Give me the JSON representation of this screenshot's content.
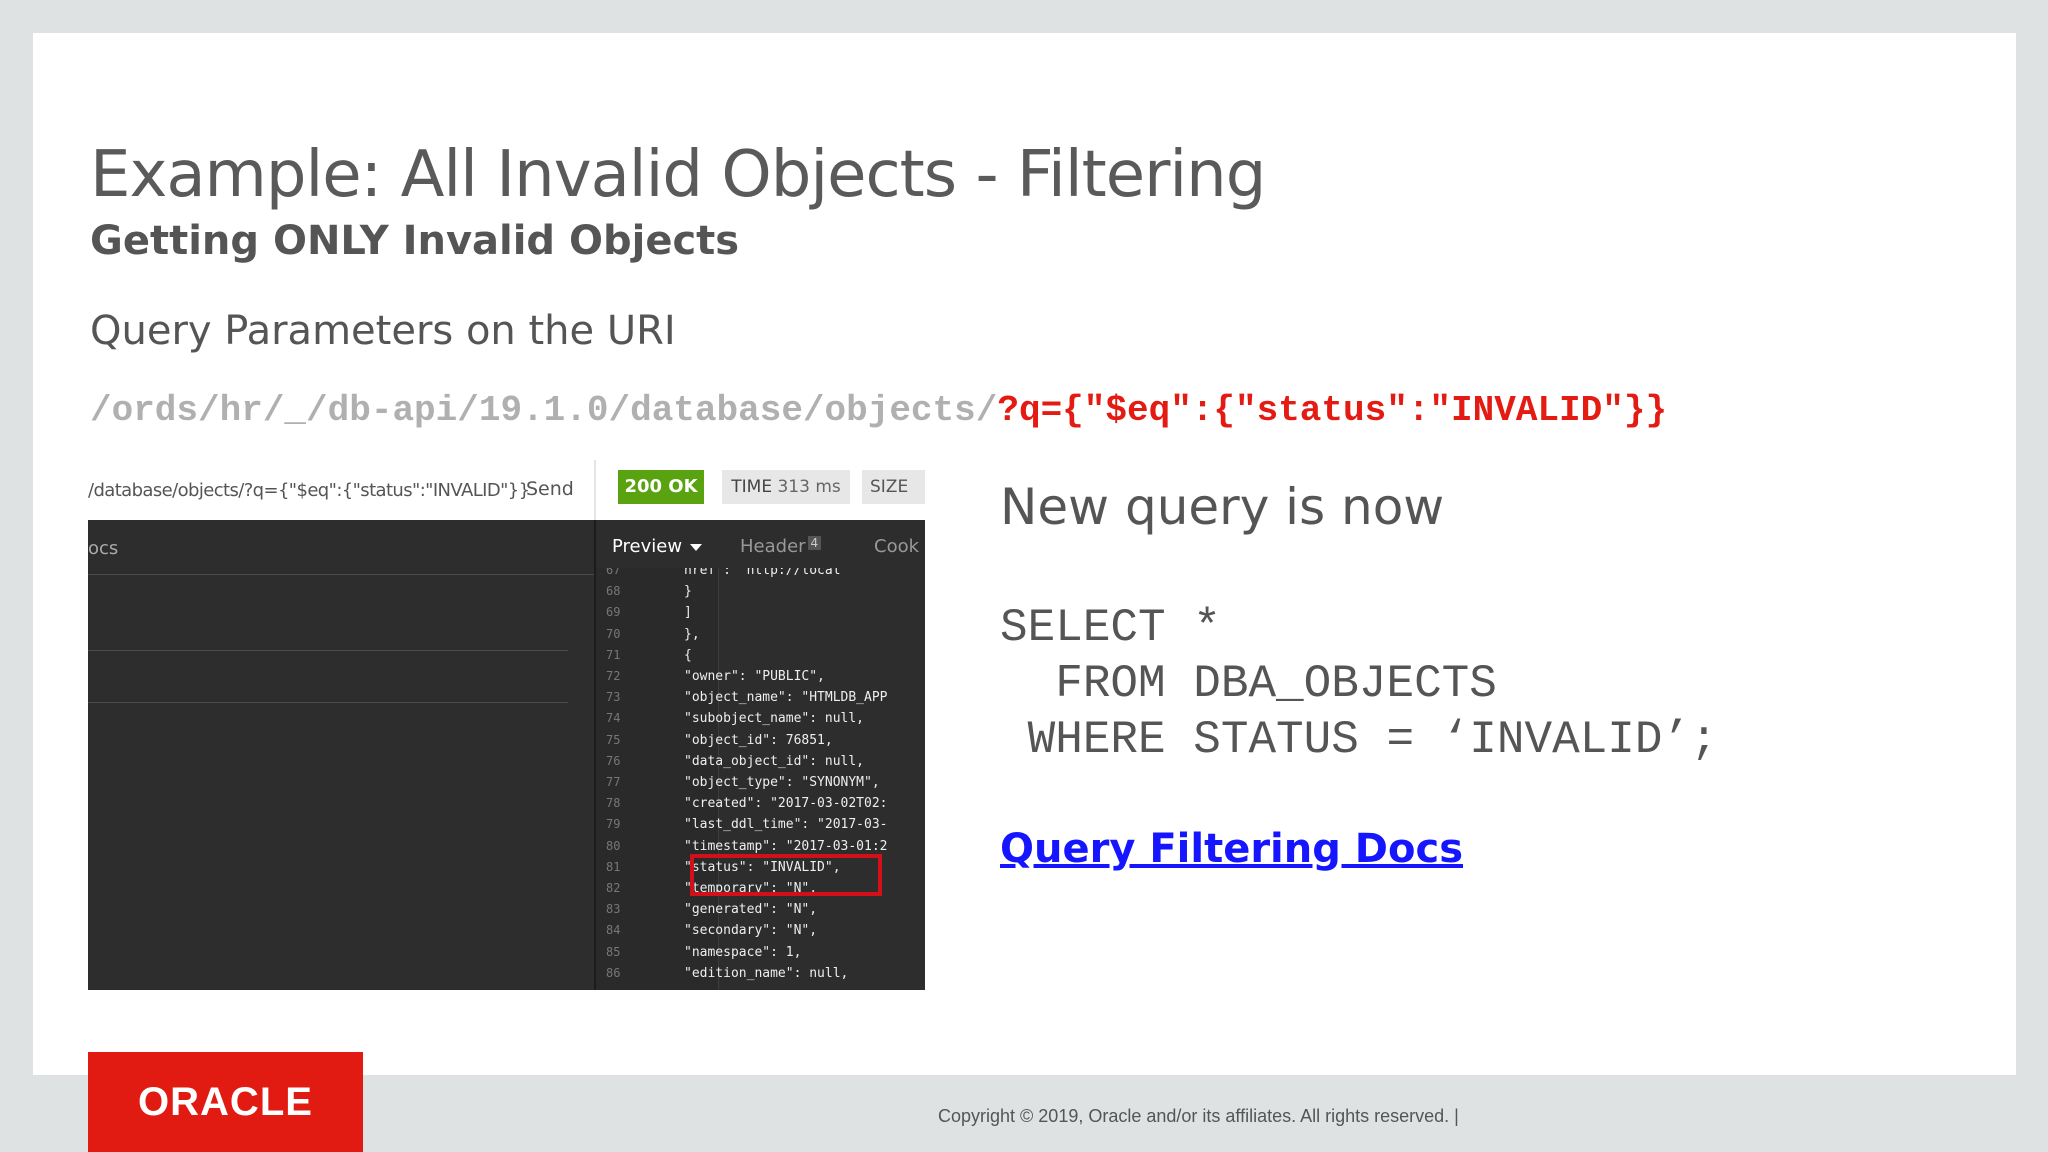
{
  "slide": {
    "title": "Example: All Invalid Objects - Filtering",
    "subtitle": "Getting ONLY Invalid Objects",
    "section_heading": "Query Parameters on the URI",
    "uri_base": "/ords/hr/_/db-api/19.1.0/database/objects/",
    "uri_query": "?q={\"$eq\":{\"status\":\"INVALID\"}}",
    "new_query_heading": "New query is now",
    "sql": "SELECT *\n  FROM DBA_OBJECTS\n WHERE STATUS = ‘INVALID’;",
    "docs_link": "Query Filtering Docs",
    "logo_text": "ORACLE",
    "copyright": "Copyright © 2019, Oracle and/or its affiliates. All rights reserved.  |"
  },
  "screenshot": {
    "url": "/database/objects/?q={\"$eq\":{\"status\":\"INVALID\"}}",
    "send_label": "Send",
    "status_badge": "200 OK",
    "time_label": "TIME",
    "time_value": "313 ms",
    "size_label": "SIZE",
    "left_tab": "ocs",
    "tabs": {
      "preview": "Preview",
      "header": "Header",
      "header_count": "4",
      "cookies": "Cook"
    },
    "code_lines": [
      {
        "n": "67",
        "t": "      href\": \"http://local"
      },
      {
        "n": "68",
        "t": "    }"
      },
      {
        "n": "69",
        "t": "  ]"
      },
      {
        "n": "70",
        "t": "},"
      },
      {
        "n": "71",
        "t": "{"
      },
      {
        "n": "72",
        "t": "  \"owner\": \"PUBLIC\","
      },
      {
        "n": "73",
        "t": "  \"object_name\": \"HTMLDB_APP"
      },
      {
        "n": "74",
        "t": "  \"subobject_name\": null,"
      },
      {
        "n": "75",
        "t": "  \"object_id\": 76851,"
      },
      {
        "n": "76",
        "t": "  \"data_object_id\": null,"
      },
      {
        "n": "77",
        "t": "  \"object_type\": \"SYNONYM\","
      },
      {
        "n": "78",
        "t": "  \"created\": \"2017-03-02T02:"
      },
      {
        "n": "79",
        "t": "  \"last_ddl_time\": \"2017-03-"
      },
      {
        "n": "80",
        "t": "  \"timestamp\": \"2017-03-01:2"
      },
      {
        "n": "81",
        "t": "  \"status\": \"INVALID\","
      },
      {
        "n": "82",
        "t": "  \"temporary\": \"N\","
      },
      {
        "n": "83",
        "t": "  \"generated\": \"N\","
      },
      {
        "n": "84",
        "t": "  \"secondary\": \"N\","
      },
      {
        "n": "85",
        "t": "  \"namespace\": 1,"
      },
      {
        "n": "86",
        "t": "  \"edition_name\": null,"
      }
    ]
  }
}
